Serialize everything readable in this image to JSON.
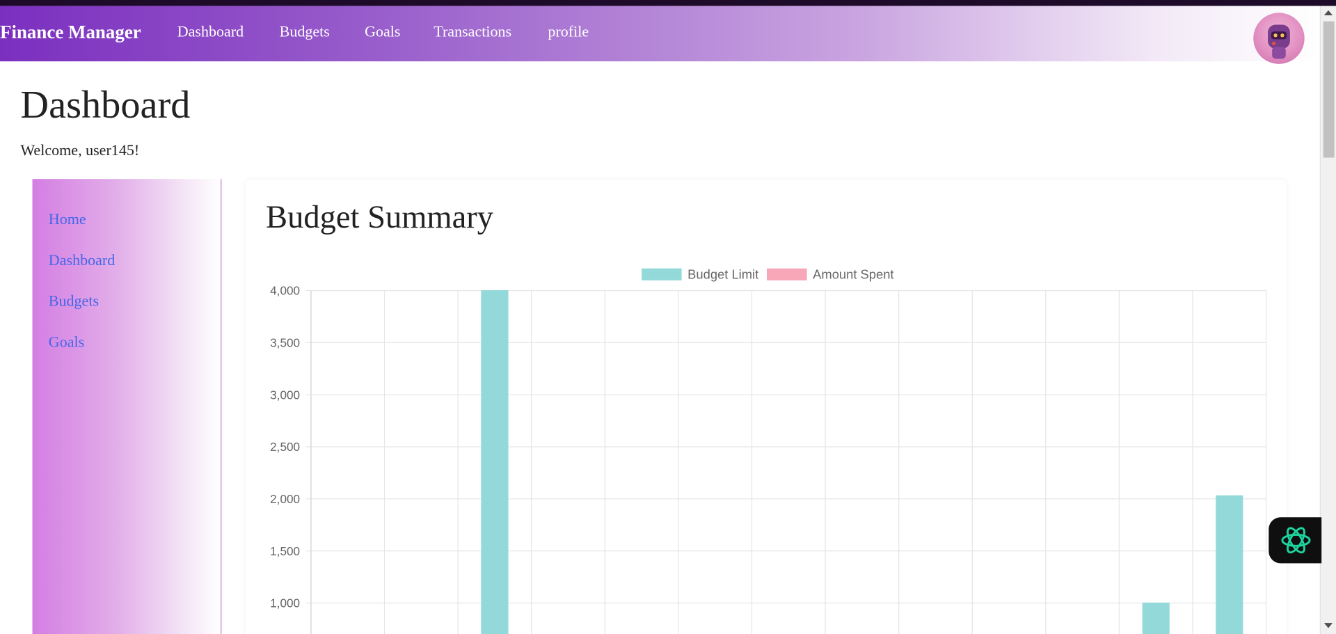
{
  "navbar": {
    "brand": "Finance Manager",
    "links": [
      "Dashboard",
      "Budgets",
      "Goals",
      "Transactions",
      "profile"
    ]
  },
  "page": {
    "title": "Dashboard",
    "welcome": "Welcome, user145!"
  },
  "sidebar": {
    "links": [
      "Home",
      "Dashboard",
      "Budgets",
      "Goals"
    ]
  },
  "card": {
    "title": "Budget Summary"
  },
  "icons": {
    "avatar": "robot-avatar-icon",
    "assistant": "openai-assistant-icon"
  },
  "colors": {
    "navbar_start": "#7b2fbf",
    "sidebar_link": "#4466e8",
    "budget_limit": "#94d9d9",
    "amount_spent": "#f7a7b8"
  },
  "chart_data": {
    "type": "bar",
    "title": "",
    "xlabel": "",
    "ylabel": "",
    "ylim": [
      700,
      4000
    ],
    "yticks": [
      4000,
      3500,
      3000,
      2500,
      2000,
      1500,
      1000
    ],
    "ytick_labels": [
      "4,000",
      "3,500",
      "3,000",
      "2,500",
      "2,000",
      "1,500",
      "1,000"
    ],
    "category_count": 13,
    "legend_position": "top",
    "grid": true,
    "series": [
      {
        "name": "Budget Limit",
        "color": "#94d9d9",
        "values": [
          null,
          null,
          4000,
          null,
          null,
          null,
          null,
          null,
          null,
          null,
          null,
          1000,
          2030
        ]
      },
      {
        "name": "Amount Spent",
        "color": "#f7a7b8",
        "values": [
          null,
          null,
          null,
          null,
          null,
          null,
          null,
          null,
          null,
          null,
          null,
          null,
          null
        ]
      }
    ]
  }
}
